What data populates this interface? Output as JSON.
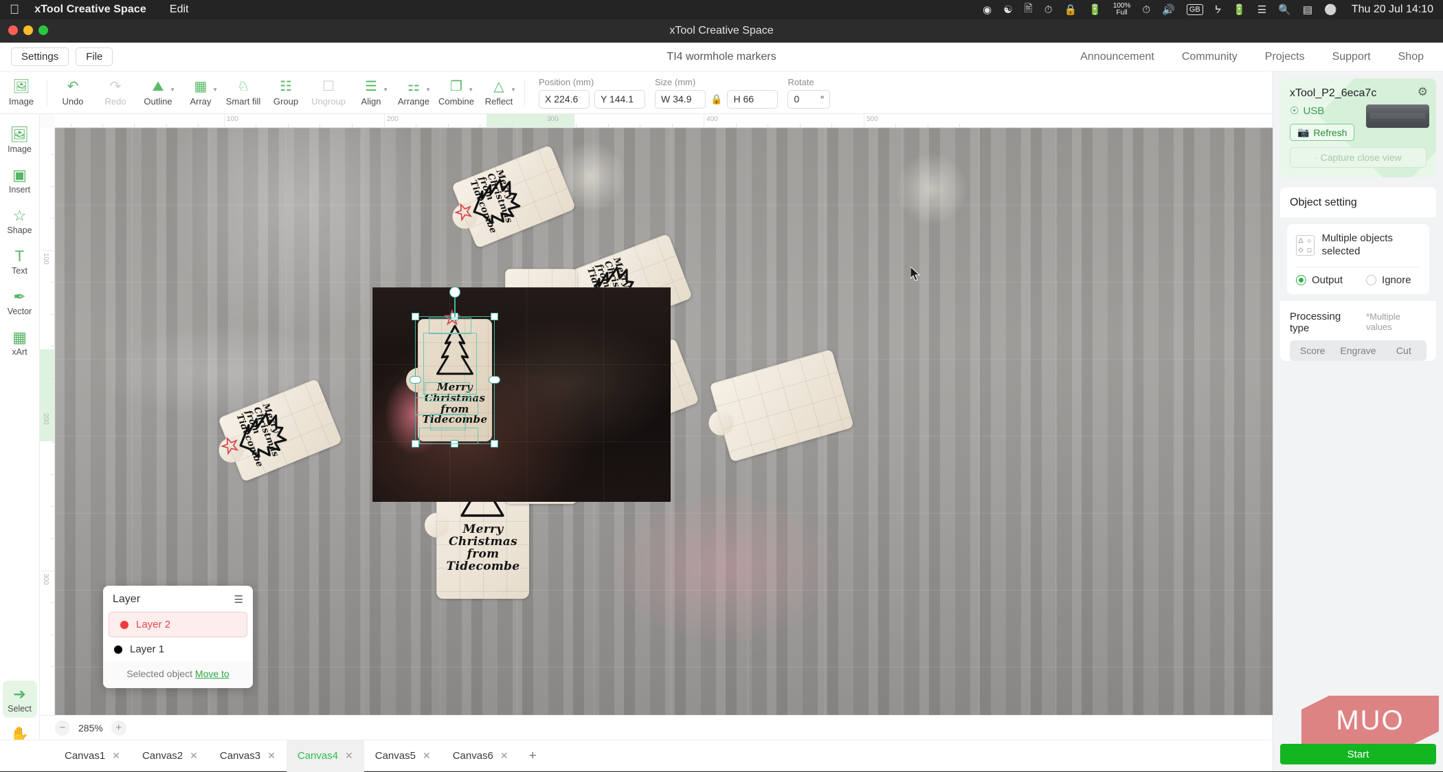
{
  "menubar": {
    "apple_icon": "apple-icon",
    "app_name": "xTool Creative Space",
    "menu_items": [
      "Edit"
    ],
    "status_icons": [
      "capsule-icon",
      "shell-icon",
      "screenshot-icon",
      "timemachine-icon",
      "lock-icon",
      "battery-icon"
    ],
    "battery_text_line1": "100%",
    "battery_text_line2": "Full",
    "more_icons": [
      "power-icon",
      "volume-icon"
    ],
    "input_source": "GB",
    "trailing_icons": [
      "bluetooth-icon",
      "battery-charging-icon",
      "wifi-icon",
      "search-icon",
      "controlcenter-icon",
      "siri-icon"
    ],
    "clock": "Thu 20 Jul  14:10"
  },
  "window": {
    "title": "xTool Creative Space"
  },
  "header": {
    "settings_label": "Settings",
    "file_label": "File",
    "document_title": "TI4 wormhole markers",
    "nav": [
      "Announcement",
      "Community",
      "Projects",
      "Support",
      "Shop"
    ]
  },
  "toolbar": {
    "image": {
      "label": "Image",
      "icon": "image-icon"
    },
    "items": [
      {
        "label": "Undo",
        "icon": "undo-icon",
        "disabled": false,
        "caret": false
      },
      {
        "label": "Redo",
        "icon": "redo-icon",
        "disabled": true,
        "caret": false
      },
      {
        "label": "Outline",
        "icon": "outline-icon",
        "disabled": false,
        "caret": true
      },
      {
        "label": "Array",
        "icon": "array-icon",
        "disabled": false,
        "caret": true
      },
      {
        "label": "Smart fill",
        "icon": "smartfill-icon",
        "disabled": false,
        "caret": false
      },
      {
        "label": "Group",
        "icon": "group-icon",
        "disabled": false,
        "caret": false
      },
      {
        "label": "Ungroup",
        "icon": "ungroup-icon",
        "disabled": true,
        "caret": false
      },
      {
        "label": "Align",
        "icon": "align-icon",
        "disabled": false,
        "caret": true
      },
      {
        "label": "Arrange",
        "icon": "arrange-icon",
        "disabled": false,
        "caret": true
      },
      {
        "label": "Combine",
        "icon": "combine-icon",
        "disabled": false,
        "caret": true
      },
      {
        "label": "Reflect",
        "icon": "reflect-icon",
        "disabled": false,
        "caret": true
      }
    ],
    "position": {
      "caption": "Position (mm)",
      "x": "X 224.6",
      "y": "Y 144.1"
    },
    "size": {
      "caption": "Size (mm)",
      "w": "W 34.9",
      "h": "H 66",
      "lock_icon": "lock-icon"
    },
    "rotate": {
      "caption": "Rotate",
      "value": "0",
      "unit": "°"
    }
  },
  "left_rail": {
    "items": [
      {
        "label": "Image",
        "icon": "image-icon"
      },
      {
        "label": "Insert",
        "icon": "insert-icon"
      },
      {
        "label": "Shape",
        "icon": "shape-star-icon"
      },
      {
        "label": "Text",
        "icon": "text-icon"
      },
      {
        "label": "Vector",
        "icon": "pen-vector-icon"
      },
      {
        "label": "xArt",
        "icon": "xart-ai-icon"
      }
    ],
    "bottom": [
      {
        "label": "Select",
        "icon": "cursor-select-icon",
        "active": true
      },
      {
        "label": "Hand",
        "icon": "hand-pan-icon",
        "active": false
      }
    ]
  },
  "canvas": {
    "ruler_h_marks": [
      "100",
      "200",
      "300",
      "400",
      "500"
    ],
    "ruler_v_marks": [
      "100",
      "200",
      "300"
    ],
    "tag_text": "Merry\nChristmas\nfrom\nTidecombe",
    "tree_icon": "christmas-tree-icon",
    "star_icon": "star-outline-icon",
    "star_color": "#d8434b",
    "selection_color": "#41b3a3",
    "cursor_icon": "arrow-cursor-icon"
  },
  "layer_panel": {
    "title": "Layer",
    "menu_icon": "layer-options-icon",
    "layers": [
      {
        "name": "Layer 2",
        "color": "#ef3b3b",
        "active": true
      },
      {
        "name": "Layer 1",
        "color": "#000000",
        "active": false
      }
    ],
    "footer_text": "Selected object",
    "footer_link": "Move to"
  },
  "zoom": {
    "minus": "−",
    "level": "285%",
    "plus": "+"
  },
  "tabs": {
    "items": [
      {
        "label": "Canvas1",
        "active": false
      },
      {
        "label": "Canvas2",
        "active": false
      },
      {
        "label": "Canvas3",
        "active": false
      },
      {
        "label": "Canvas4",
        "active": true
      },
      {
        "label": "Canvas5",
        "active": false
      },
      {
        "label": "Canvas6",
        "active": false
      }
    ],
    "close_icon": "close-icon",
    "add_label": "+"
  },
  "right_panel": {
    "device": {
      "name": "xTool_P2_6eca7c",
      "connection": "USB",
      "connection_icon": "usb-icon",
      "gear_icon": "gear-icon",
      "refresh_label": "Refresh",
      "refresh_icon": "camera-refresh-icon",
      "capture_label": "· Capture close view"
    },
    "object_setting": {
      "title": "Object setting",
      "selection_icon": "multiple-shapes-icon",
      "selection_text": "Multiple objects selected",
      "output_label": "Output",
      "ignore_label": "Ignore",
      "output_selected": true,
      "processing_label": "Processing type",
      "processing_note": "*Multiple values",
      "processing_types": [
        "Score",
        "Engrave",
        "Cut"
      ]
    },
    "start_label": "Start",
    "watermark": "MUO"
  }
}
